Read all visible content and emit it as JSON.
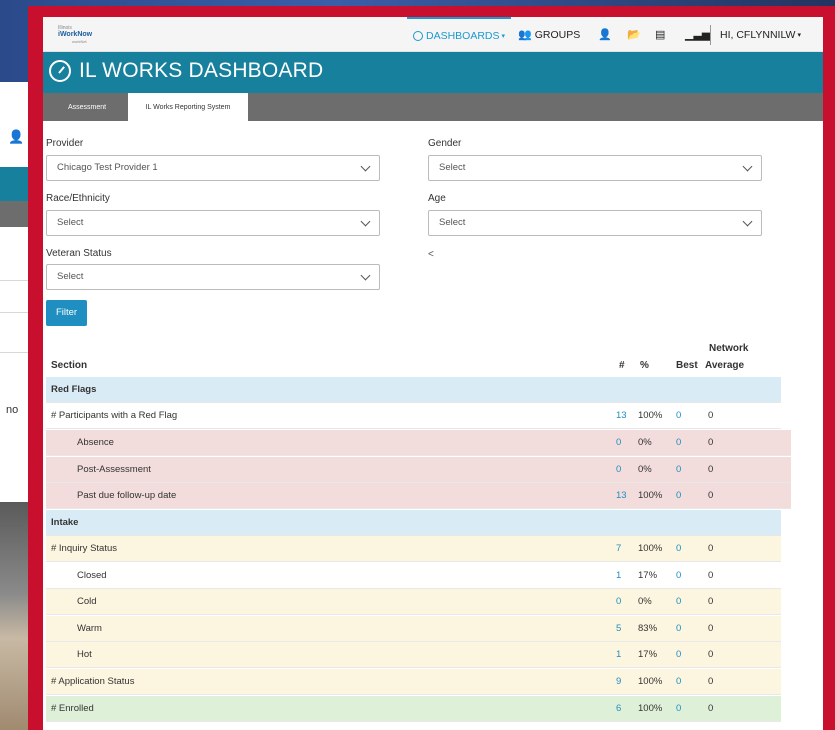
{
  "background": {
    "no_text": "no"
  },
  "nav": {
    "logo": {
      "line1": "Illinois",
      "line2": "iWorkNow",
      "line3": "workNet"
    },
    "dashboards": "DASHBOARDS",
    "groups": "GROUPS",
    "user": "HI, CFLYNNILW"
  },
  "header": {
    "title": "IL WORKS DASHBOARD",
    "tabs": [
      {
        "label": "Assessment"
      },
      {
        "label": "IL Works Reporting System"
      }
    ]
  },
  "filters": {
    "provider": {
      "label": "Provider",
      "value": "Chicago Test Provider 1"
    },
    "gender": {
      "label": "Gender",
      "value": "Select"
    },
    "race": {
      "label": "Race/Ethnicity",
      "value": "Select"
    },
    "age": {
      "label": "Age",
      "value": "Select"
    },
    "veteran": {
      "label": "Veteran Status",
      "value": "Select"
    },
    "lt": "<",
    "button": "Filter"
  },
  "table": {
    "headers": {
      "section": "Section",
      "num": "#",
      "pct": "%",
      "best": "Best",
      "avg_line1": "Network",
      "avg_line2": "Average"
    },
    "rows": [
      {
        "name": "Red Flags",
        "type": "section"
      },
      {
        "name": "# Participants with a Red Flag",
        "num": "13",
        "pct": "100%",
        "best": "0",
        "avg": "0",
        "type": "plain"
      },
      {
        "name": "Absence",
        "num": "0",
        "pct": "0%",
        "best": "0",
        "avg": "0",
        "type": "red"
      },
      {
        "name": "Post-Assessment",
        "num": "0",
        "pct": "0%",
        "best": "0",
        "avg": "0",
        "type": "red"
      },
      {
        "name": "Past due follow-up date",
        "num": "13",
        "pct": "100%",
        "best": "0",
        "avg": "0",
        "type": "red"
      },
      {
        "name": "Intake",
        "type": "section"
      },
      {
        "name": "# Inquiry Status",
        "num": "7",
        "pct": "100%",
        "best": "0",
        "avg": "0",
        "type": "yellow"
      },
      {
        "name": "Closed",
        "num": "1",
        "pct": "17%",
        "best": "0",
        "avg": "0",
        "type": "white"
      },
      {
        "name": "Cold",
        "num": "0",
        "pct": "0%",
        "best": "0",
        "avg": "0",
        "type": "yellow"
      },
      {
        "name": "Warm",
        "num": "5",
        "pct": "83%",
        "best": "0",
        "avg": "0",
        "type": "yellow"
      },
      {
        "name": "Hot",
        "num": "1",
        "pct": "17%",
        "best": "0",
        "avg": "0",
        "type": "yellow"
      },
      {
        "name": "# Application Status",
        "num": "9",
        "pct": "100%",
        "best": "0",
        "avg": "0",
        "type": "yellow"
      },
      {
        "name": "# Enrolled",
        "num": "6",
        "pct": "100%",
        "best": "0",
        "avg": "0",
        "type": "green"
      }
    ]
  },
  "colors": {
    "frame": "#c8102e",
    "title_bar": "#17809d",
    "tab_bar": "#6d6d6d",
    "accent": "#1f8fc1",
    "section_row": "#d9ecf6",
    "red_row": "#f2dcdc",
    "yellow_row": "#fcf5df",
    "green_row": "#dff0d8"
  },
  "icons": {
    "dashboard": "dashboard-gauge-icon",
    "groups": "groups-icon",
    "user": "user-icon",
    "folder": "folder-icon",
    "list": "list-icon",
    "chart": "bar-chart-icon"
  }
}
